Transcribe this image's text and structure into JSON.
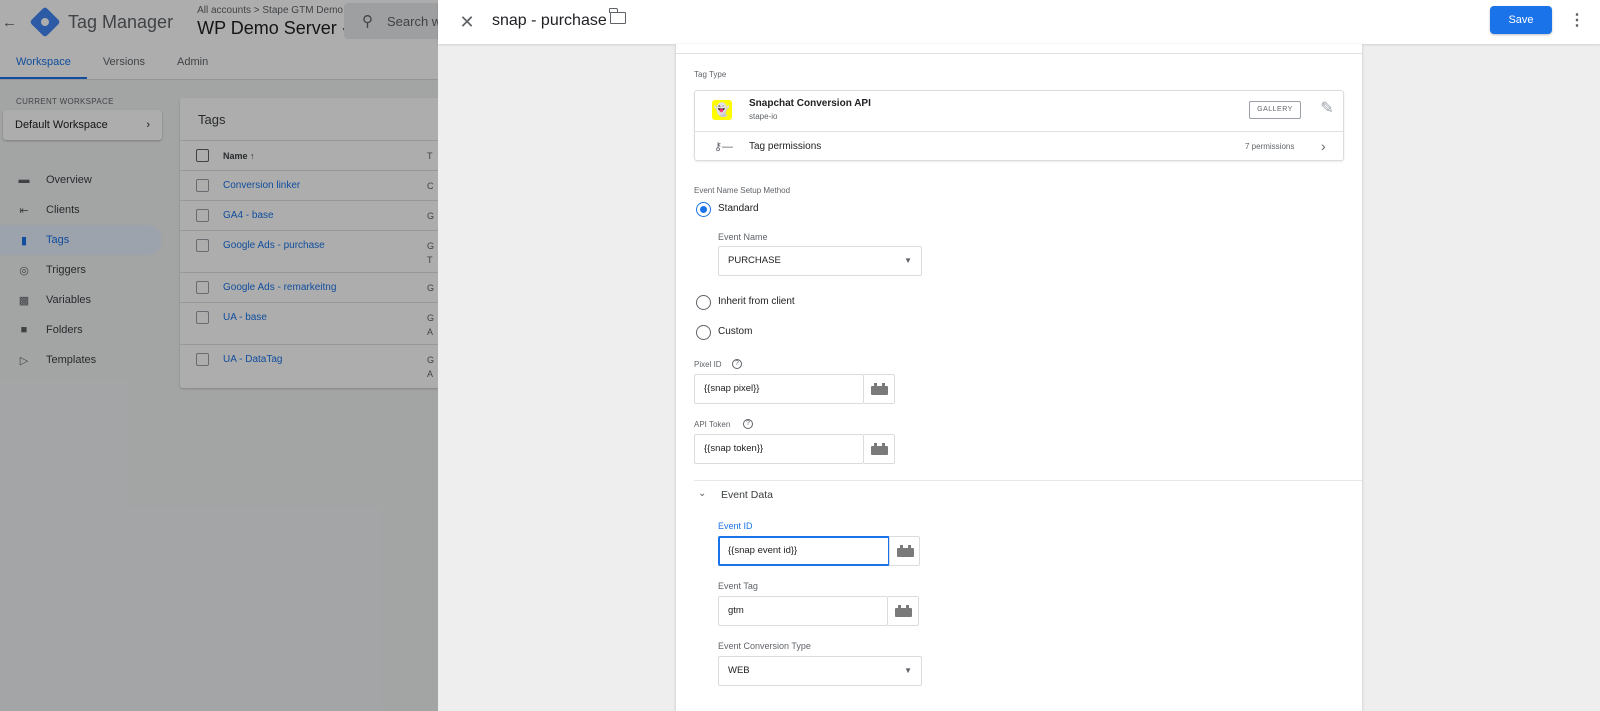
{
  "app": {
    "product_name": "Tag Manager",
    "breadcrumb": "All accounts  >  Stape GTM Demo",
    "container_name": "WP Demo Server",
    "search_placeholder": "Search w"
  },
  "nav_tabs": [
    "Workspace",
    "Versions",
    "Admin"
  ],
  "sidebar": {
    "workspace_label": "CURRENT WORKSPACE",
    "workspace_name": "Default Workspace",
    "items": [
      {
        "label": "Overview",
        "icon": "overview-icon"
      },
      {
        "label": "Clients",
        "icon": "clients-icon"
      },
      {
        "label": "Tags",
        "icon": "tag-icon"
      },
      {
        "label": "Triggers",
        "icon": "trigger-icon"
      },
      {
        "label": "Variables",
        "icon": "variables-icon"
      },
      {
        "label": "Folders",
        "icon": "folder-icon"
      },
      {
        "label": "Templates",
        "icon": "templates-icon"
      }
    ]
  },
  "tags_table": {
    "title": "Tags",
    "header_name": "Name ↑",
    "header_type": "T",
    "rows": [
      {
        "name": "Conversion linker",
        "type": "C"
      },
      {
        "name": "GA4 - base",
        "type": "G"
      },
      {
        "name": "Google Ads - purchase",
        "type": "G\nT"
      },
      {
        "name": "Google Ads - remarkeitng",
        "type": "G"
      },
      {
        "name": "UA - base",
        "type": "G\nA"
      },
      {
        "name": "UA - DataTag",
        "type": "G\nA"
      }
    ]
  },
  "drawer": {
    "title": "snap - purchase",
    "save_label": "Save"
  },
  "config": {
    "tag_type_label": "Tag Type",
    "tag_type_name": "Snapchat Conversion API",
    "tag_type_vendor": "stape-io",
    "gallery_label": "GALLERY",
    "permissions_label": "Tag permissions",
    "permissions_count": "7 permissions",
    "event_setup_label": "Event Name Setup Method",
    "radio_standard": "Standard",
    "event_name_label": "Event Name",
    "event_name_value": "PURCHASE",
    "radio_inherit": "Inherit from client",
    "radio_custom": "Custom",
    "pixel_id_label": "Pixel ID",
    "pixel_id_value": "{{snap pixel}}",
    "api_token_label": "API Token",
    "api_token_value": "{{snap token}}",
    "event_data_title": "Event Data",
    "event_id_label": "Event ID",
    "event_id_value": "{{snap event id}}",
    "event_tag_label": "Event Tag",
    "event_tag_value": "gtm",
    "event_conv_type_label": "Event Conversion Type",
    "event_conv_type_value": "WEB"
  },
  "colors": {
    "accent": "#1a73e8",
    "snapchat_yellow": "#fffc00"
  }
}
